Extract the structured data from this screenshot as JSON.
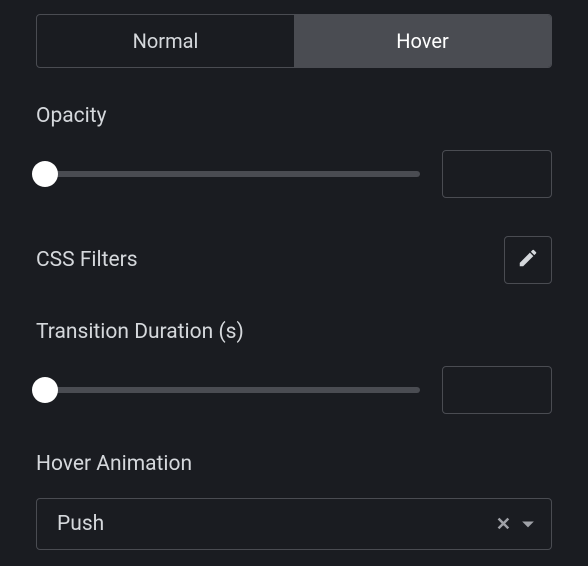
{
  "tabs": {
    "normal": "Normal",
    "hover": "Hover",
    "active": "hover"
  },
  "opacity": {
    "label": "Opacity",
    "value": ""
  },
  "cssFilters": {
    "label": "CSS Filters"
  },
  "transitionDuration": {
    "label": "Transition Duration (s)",
    "value": ""
  },
  "hoverAnimation": {
    "label": "Hover Animation",
    "selected": "Push"
  }
}
